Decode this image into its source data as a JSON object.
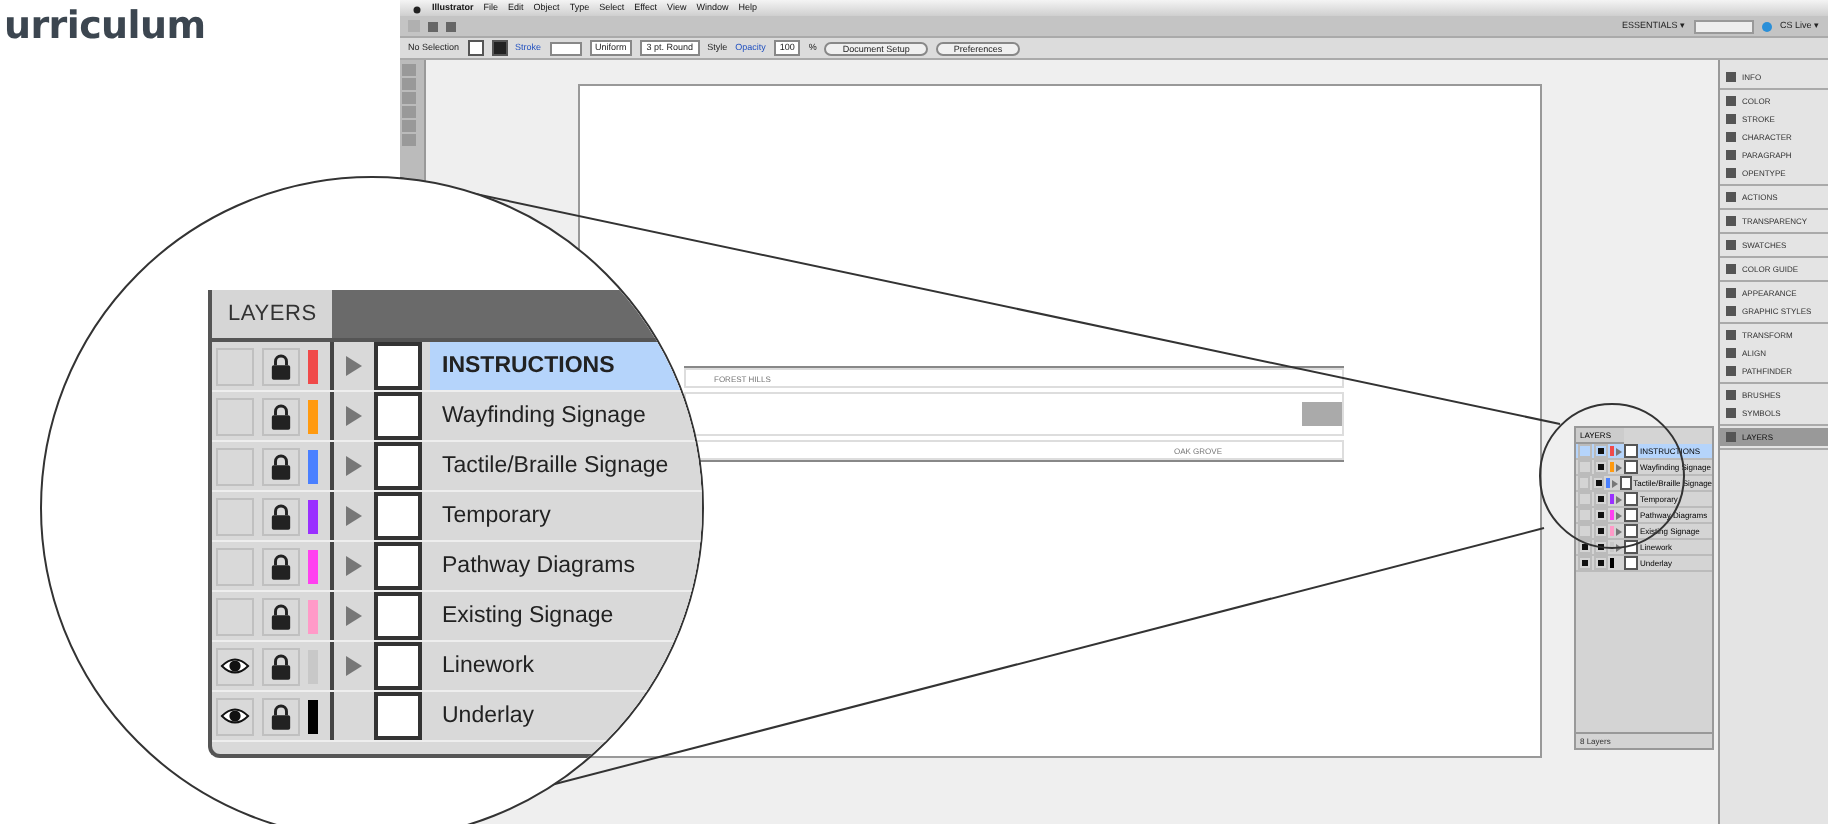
{
  "heading": "urriculum",
  "menu": [
    "Illustrator",
    "File",
    "Edit",
    "Object",
    "Type",
    "Select",
    "Effect",
    "View",
    "Window",
    "Help"
  ],
  "workspace": "ESSENTIALS ▾",
  "cs_live": "CS Live ▾",
  "control_bar": {
    "selection": "No Selection",
    "stroke_label": "Stroke",
    "profile": "Uniform",
    "brush": "3 pt. Round",
    "style_label": "Style",
    "opacity_label": "Opacity",
    "opacity": "100",
    "percent": "%",
    "buttons": [
      "Document Setup",
      "Preferences"
    ]
  },
  "artwork": {
    "labels": [
      "FOREST HILLS",
      "OAK GROVE"
    ]
  },
  "dock": [
    [
      {
        "label": "INFO",
        "selected": false
      }
    ],
    [
      {
        "label": "COLOR",
        "selected": false
      },
      {
        "label": "STROKE",
        "selected": false
      },
      {
        "label": "CHARACTER",
        "selected": false
      },
      {
        "label": "PARAGRAPH",
        "selected": false
      },
      {
        "label": "OPENTYPE",
        "selected": false
      }
    ],
    [
      {
        "label": "ACTIONS",
        "selected": false
      }
    ],
    [
      {
        "label": "TRANSPARENCY",
        "selected": false
      }
    ],
    [
      {
        "label": "SWATCHES",
        "selected": false
      }
    ],
    [
      {
        "label": "COLOR GUIDE",
        "selected": false
      }
    ],
    [
      {
        "label": "APPEARANCE",
        "selected": false
      },
      {
        "label": "GRAPHIC STYLES",
        "selected": false
      }
    ],
    [
      {
        "label": "TRANSFORM",
        "selected": false
      },
      {
        "label": "ALIGN",
        "selected": false
      },
      {
        "label": "PATHFINDER",
        "selected": false
      }
    ],
    [
      {
        "label": "BRUSHES",
        "selected": false
      },
      {
        "label": "SYMBOLS",
        "selected": false
      }
    ],
    [
      {
        "label": "LAYERS",
        "selected": true
      }
    ]
  ],
  "layers_panel": {
    "tab": "LAYERS",
    "count": "8 Layers",
    "layers": [
      {
        "name": "INSTRUCTIONS",
        "visible": false,
        "locked": true,
        "color": "#f04a4a",
        "expandable": true,
        "selected": true
      },
      {
        "name": "Wayfinding Signage",
        "visible": false,
        "locked": true,
        "color": "#ff9a10",
        "expandable": true,
        "selected": false
      },
      {
        "name": "Tactile/Braille Signage",
        "visible": false,
        "locked": true,
        "color": "#4a80ff",
        "expandable": true,
        "selected": false
      },
      {
        "name": "Temporary",
        "visible": false,
        "locked": true,
        "color": "#9a30ff",
        "expandable": true,
        "selected": false
      },
      {
        "name": "Pathway Diagrams",
        "visible": false,
        "locked": true,
        "color": "#ff40f0",
        "expandable": true,
        "selected": false
      },
      {
        "name": "Existing Signage",
        "visible": false,
        "locked": true,
        "color": "#ff9ac8",
        "expandable": true,
        "selected": false
      },
      {
        "name": "Linework",
        "visible": true,
        "locked": true,
        "color": "#c8c8c8",
        "expandable": true,
        "selected": false
      },
      {
        "name": "Underlay",
        "visible": true,
        "locked": true,
        "color": "#000000",
        "expandable": false,
        "selected": false
      }
    ]
  },
  "magnifier": {
    "tab": "LAYERS",
    "layers": [
      {
        "name": "INSTRUCTIONS",
        "visible": false,
        "locked": true,
        "color": "#f04a4a",
        "expandable": true,
        "selected": true
      },
      {
        "name": "Wayfinding Signage",
        "visible": false,
        "locked": true,
        "color": "#ff9a10",
        "expandable": true,
        "selected": false
      },
      {
        "name": "Tactile/Braille Signage",
        "visible": false,
        "locked": true,
        "color": "#4a80ff",
        "expandable": true,
        "selected": false
      },
      {
        "name": "Temporary",
        "visible": false,
        "locked": true,
        "color": "#9a30ff",
        "expandable": true,
        "selected": false
      },
      {
        "name": "Pathway Diagrams",
        "visible": false,
        "locked": true,
        "color": "#ff40f0",
        "expandable": true,
        "selected": false
      },
      {
        "name": "Existing Signage",
        "visible": false,
        "locked": true,
        "color": "#ff9ac8",
        "expandable": true,
        "selected": false
      },
      {
        "name": "Linework",
        "visible": true,
        "locked": true,
        "color": "#c8c8c8",
        "expandable": true,
        "selected": false
      },
      {
        "name": "Underlay",
        "visible": true,
        "locked": true,
        "color": "#000000",
        "expandable": false,
        "selected": false
      }
    ]
  }
}
